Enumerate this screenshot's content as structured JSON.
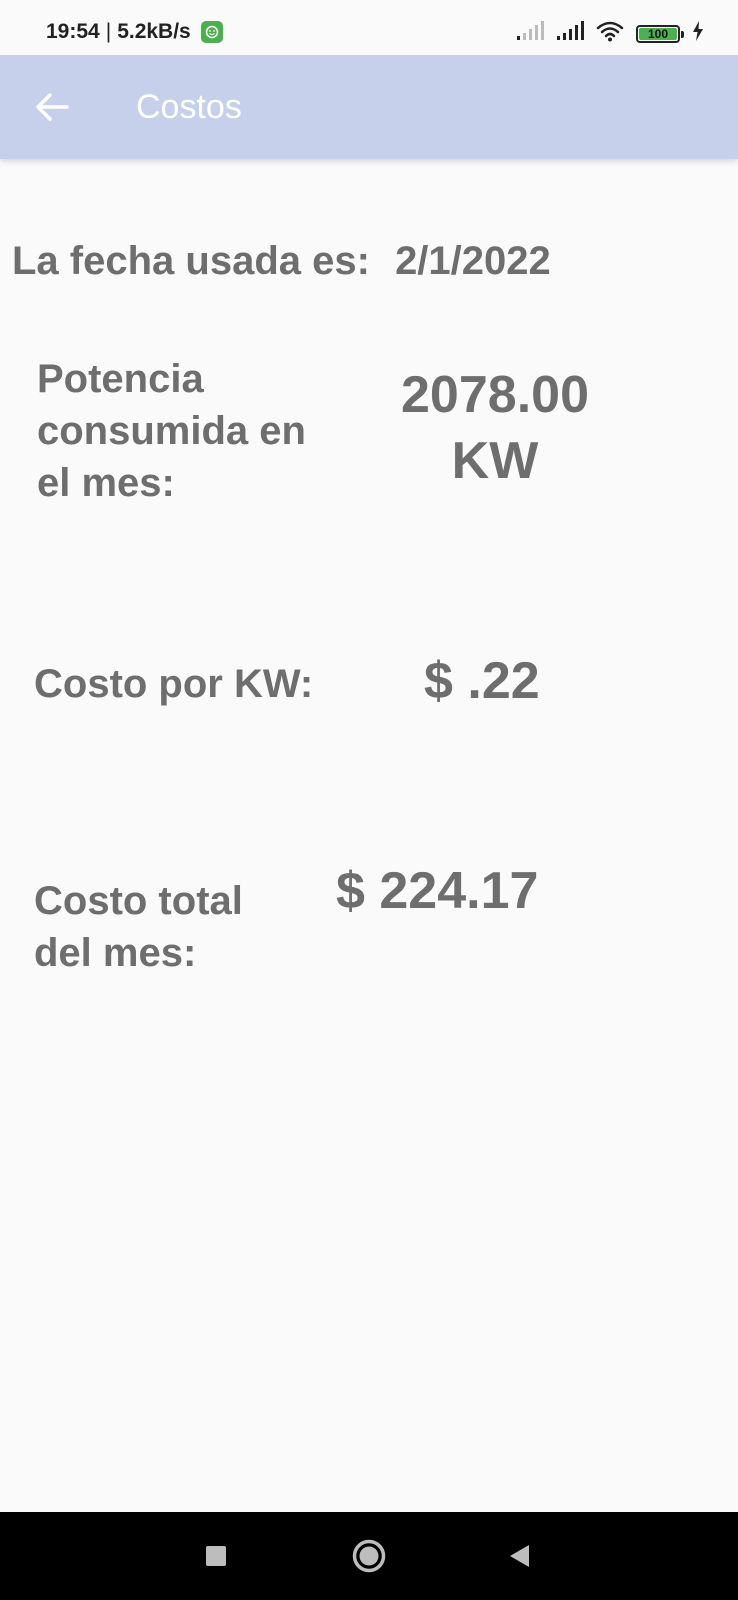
{
  "status_bar": {
    "time": "19:54",
    "separator": "|",
    "network_speed": "5.2kB/s",
    "battery_level": "100",
    "icons": [
      "app-notification-icon",
      "signal-weak-icon",
      "signal-icon",
      "wifi-icon",
      "battery-icon",
      "charging-icon"
    ]
  },
  "app_bar": {
    "title": "Costos",
    "back_icon": "arrow-left-icon",
    "color": "#c7d0eb"
  },
  "content": {
    "date_label": "La fecha usada es:",
    "date_value": "2/1/2022",
    "power_label_line1": "Potencia",
    "power_label_line2": "consumida en",
    "power_label_line3": "el mes:",
    "power_value_line1": "2078.00",
    "power_value_line2": "KW",
    "cost_per_kw_label": "Costo por KW:",
    "cost_per_kw_value": "$ .22",
    "total_cost_label_line1": "Costo total",
    "total_cost_label_line2": "del mes:",
    "total_cost_value": "$ 224.17",
    "text_color": "#6e6e6e"
  },
  "nav_bar": {
    "icons": [
      "recent-apps-icon",
      "home-icon",
      "back-icon"
    ]
  }
}
